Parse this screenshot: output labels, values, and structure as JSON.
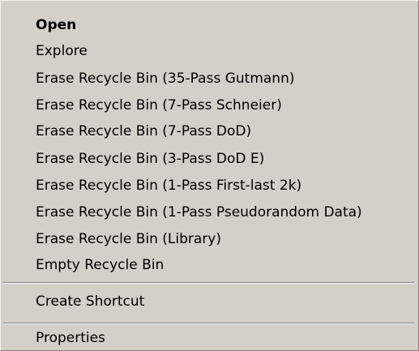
{
  "menu": {
    "items": [
      {
        "label": "Open",
        "bold": true
      },
      {
        "label": "Explore"
      },
      {
        "label": "Erase Recycle Bin (35-Pass Gutmann)"
      },
      {
        "label": "Erase Recycle Bin (7-Pass Schneier)"
      },
      {
        "label": "Erase Recycle Bin (7-Pass DoD)"
      },
      {
        "label": "Erase Recycle Bin (3-Pass DoD E)"
      },
      {
        "label": "Erase Recycle Bin (1-Pass First-last 2k)"
      },
      {
        "label": "Erase Recycle Bin (1-Pass Pseudorandom Data)"
      },
      {
        "label": "Erase Recycle Bin (Library)"
      },
      {
        "label": "Empty Recycle Bin"
      },
      {
        "label": "Create Shortcut"
      },
      {
        "label": "Properties"
      }
    ]
  },
  "colors": {
    "menu_background": "#d4d0c8",
    "text": "#000000",
    "separator_dark": "#808080",
    "separator_light": "#ffffff"
  }
}
